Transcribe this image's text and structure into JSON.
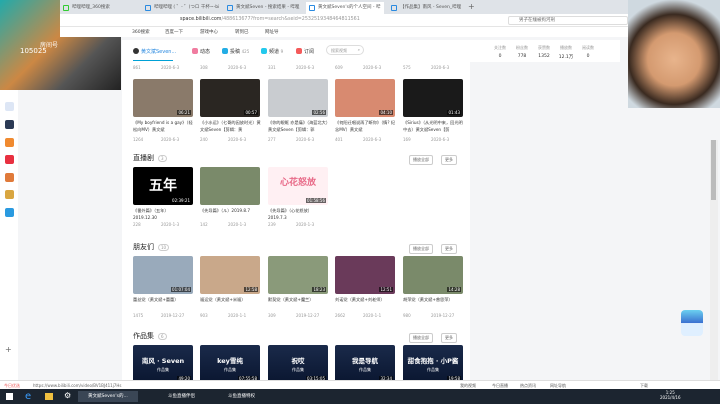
{
  "webcam_overlay": {
    "label": "房间号",
    "room": "105025"
  },
  "tabs": [
    {
      "label": "哔哩哔哩_360搜索"
    },
    {
      "label": "哔哩哔哩 ( ゜- ゜)つロ 干杯~-bi"
    },
    {
      "label": "黄文斌Seven - 搜索结果 - 哔哩"
    },
    {
      "label": "黄文斌Seven's的个人空间 - 哔"
    },
    {
      "label": "【作品集】南风 - Seven_哔哩"
    }
  ],
  "address": {
    "domain": "space.bilibili.com",
    "path": "/488613677?from=search&seid=2532519348464811561",
    "search_placeholder": "男子在缅被拘河刑"
  },
  "bookmarks": [
    "360搜索",
    "百度一下",
    "游戏中心",
    "转到已",
    "网址导"
  ],
  "nav": {
    "user": "黄文斌Seven...",
    "items": [
      {
        "label": "动态",
        "count": ""
      },
      {
        "label": "投稿",
        "count": "425"
      },
      {
        "label": "频道",
        "count": "9"
      },
      {
        "label": "订阅",
        "count": ""
      }
    ],
    "search_placeholder": "搜索视频"
  },
  "stats": [
    {
      "label": "关注数",
      "value": "0"
    },
    {
      "label": "粉丝数",
      "value": "778"
    },
    {
      "label": "获赞数",
      "value": "1352"
    },
    {
      "label": "播放数",
      "value": "12.1万"
    },
    {
      "label": "阅读数",
      "value": "0"
    }
  ],
  "top_stats": [
    {
      "views": "861",
      "date": "2020-6-3"
    },
    {
      "views": "308",
      "date": "2020-6-3"
    },
    {
      "views": "331",
      "date": "2020-6-3"
    },
    {
      "views": "609",
      "date": "2020-6-3"
    },
    {
      "views": "575",
      "date": "2020-6-3"
    }
  ],
  "videos": [
    {
      "title": "《My boyfriend is a gay》（轻松向MV）黄文斌",
      "duration": "06:21",
      "views": "1264",
      "date": "2020-6-3"
    },
    {
      "title": "《小水运》（七哥的因放时光）黄文斌Seven【剪辑：黄",
      "duration": "00:57",
      "views": "240",
      "date": "2020-6-3"
    },
    {
      "title": "《你的眼眶 亦是痛》（海蓝北大）黄文斌Seven【剪辑：郭",
      "duration": "02:56",
      "views": "277",
      "date": "2020-6-3"
    },
    {
      "title": "《何阳迁唱说再了断你》（情? 纪念MV）黄文斌",
      "duration": "04:10",
      "views": "401",
      "date": "2020-6-3"
    },
    {
      "title": "《Sirius》（从光明中来，回光明中去）黄文斌Seven【剪",
      "duration": "01:43",
      "views": "169",
      "date": "2020-6-3"
    }
  ],
  "sections": {
    "live": {
      "title": "直播剧",
      "count": "3",
      "play_all": "播放全部",
      "more": "更多",
      "items": [
        {
          "title": "《番外篇》（五年）",
          "sub": "2019.12.30",
          "duration": "02:39:21",
          "views": "228",
          "date": "2020-1-3",
          "art": "五年"
        },
        {
          "title": "《先导篇》（ル）2019.8.7",
          "sub": "",
          "duration": "",
          "views": "142",
          "date": "2020-1-3",
          "art": ""
        },
        {
          "title": "《先导篇》（心花怒放）",
          "sub": "2019.7.3",
          "duration": "01:58:56",
          "views": "239",
          "date": "2020-1-3",
          "art": "心花怒放"
        }
      ]
    },
    "friends": {
      "title": "朋友们",
      "count": "10",
      "play_all": "播放全部",
      "more": "更多",
      "items": [
        {
          "title": "蕾丝党（黄文斌+蕾蕾）",
          "duration": "01:07:04",
          "views": "1475",
          "date": "2019-12-27"
        },
        {
          "title": "福运党（黄文斌+米福）",
          "duration": "12:58",
          "views": "903",
          "date": "2020-1-1"
        },
        {
          "title": "默契党（黄文斌+魔兰）",
          "duration": "18:23",
          "views": "309",
          "date": "2019-12-27"
        },
        {
          "title": "刘诺党（黄文斌+刘老师）",
          "duration": "12:51",
          "views": "2662",
          "date": "2020-1-1"
        },
        {
          "title": "胡萍党（黄文斌+曾思萍）",
          "duration": "14:28",
          "views": "980",
          "date": "2019-12-27"
        }
      ]
    },
    "works": {
      "title": "作品集",
      "count": "6",
      "play_all": "播放全部",
      "more": "更多",
      "items": [
        {
          "title": "南风 · Seven",
          "tag": "作品集",
          "duration": "49:20"
        },
        {
          "title": "key雪纯",
          "tag": "作品集",
          "duration": "07:55:58"
        },
        {
          "title": "祝哎",
          "tag": "作品集",
          "duration": "03:15:05"
        },
        {
          "title": "我是导航",
          "tag": "作品集",
          "duration": "32:34"
        },
        {
          "title": "甜食抱抱 · 小P酱",
          "tag": "作品集",
          "duration": "19:58"
        }
      ]
    }
  },
  "statusbar": {
    "left": "今日优选",
    "url": "https://www.bilibili.com/video/BV1BJ411j7Hs",
    "right": [
      "我的视频",
      "今日直播",
      "热点资讯",
      "网址导航",
      "下载"
    ]
  },
  "taskbar": {
    "items": [
      "黄文斌Seven's的...",
      "斗鱼直播伴侣",
      "斗鱼直播特权"
    ],
    "time": "1:25",
    "date": "2021/4/16"
  }
}
